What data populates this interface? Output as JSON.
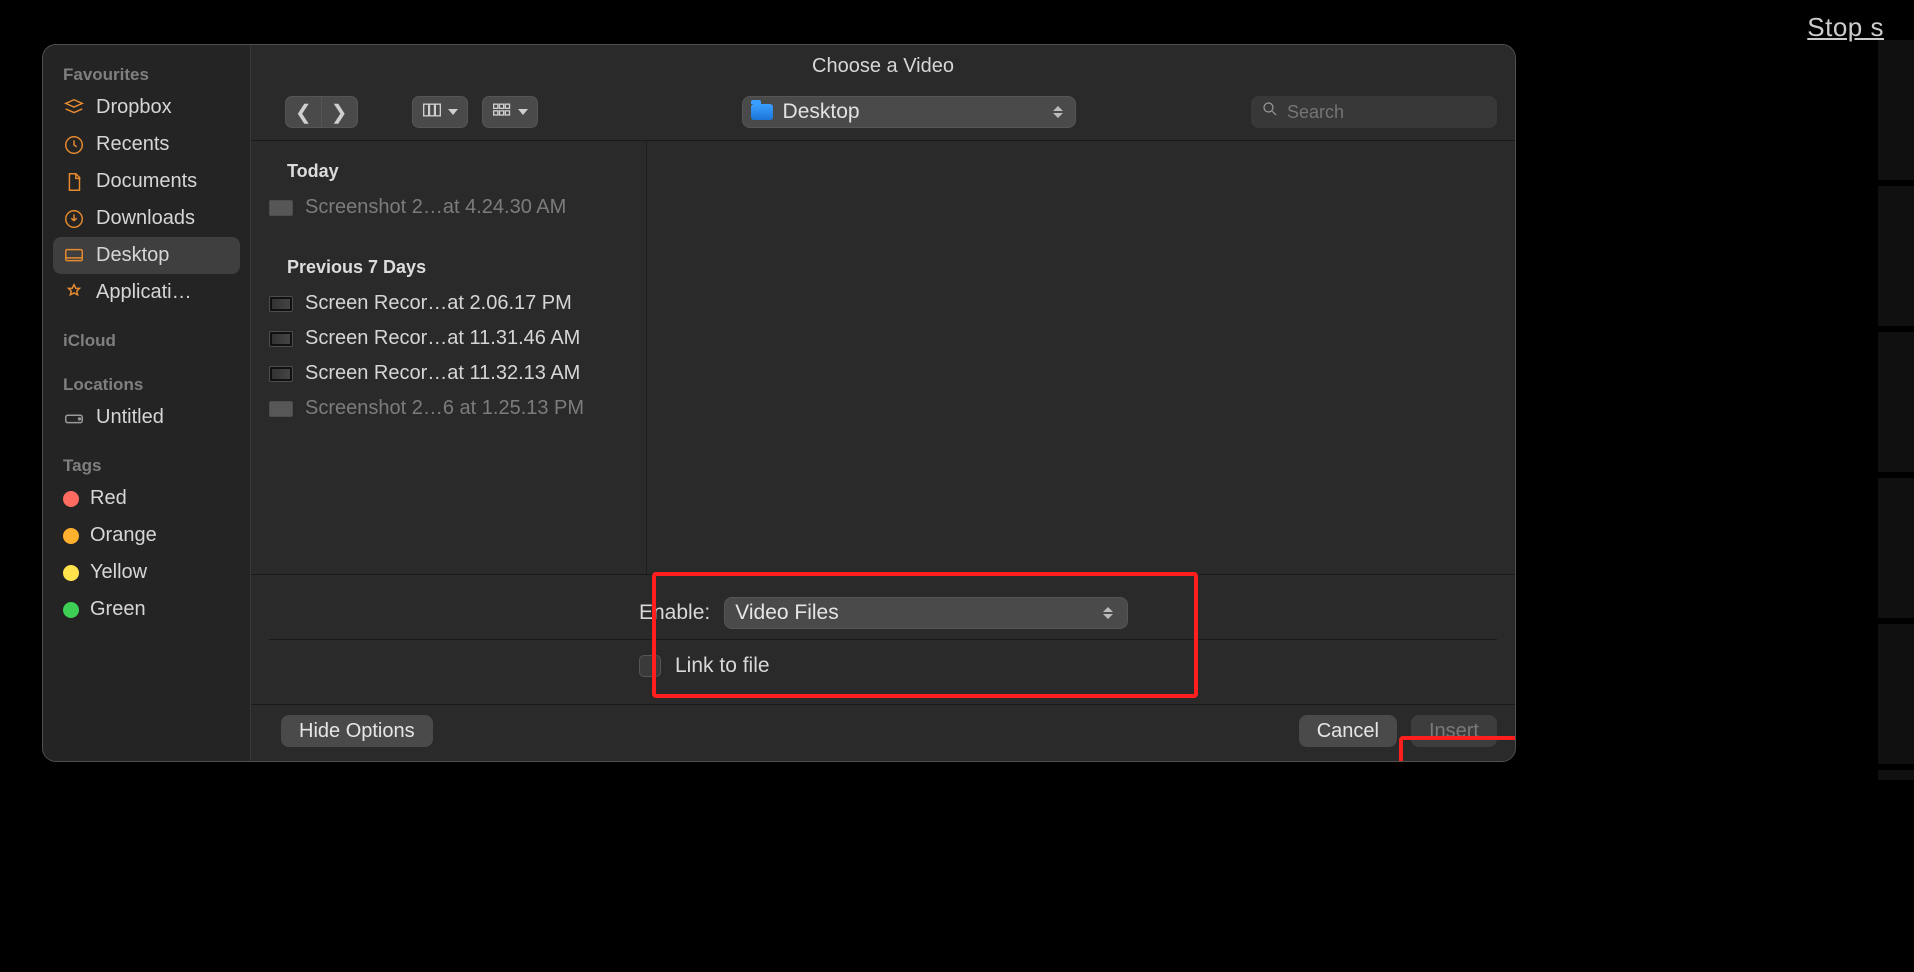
{
  "topbar": {
    "stop_share": "Stop s"
  },
  "dialog": {
    "title": "Choose a Video",
    "location": {
      "label": "Desktop"
    },
    "search": {
      "placeholder": "Search"
    },
    "sidebar": {
      "sections": [
        {
          "label": "Favourites",
          "items": [
            {
              "icon": "box",
              "label": "Dropbox"
            },
            {
              "icon": "clock",
              "label": "Recents"
            },
            {
              "icon": "doc",
              "label": "Documents"
            },
            {
              "icon": "download",
              "label": "Downloads"
            },
            {
              "icon": "desktop",
              "label": "Desktop",
              "selected": true
            },
            {
              "icon": "apps",
              "label": "Applicati…"
            }
          ]
        },
        {
          "label": "iCloud",
          "items": []
        },
        {
          "label": "Locations",
          "items": [
            {
              "icon": "disk",
              "label": "Untitled"
            }
          ]
        },
        {
          "label": "Tags",
          "items": [
            {
              "dot": "#ff6b60",
              "label": "Red"
            },
            {
              "dot": "#ffb02e",
              "label": "Orange"
            },
            {
              "dot": "#ffe34d",
              "label": "Yellow"
            },
            {
              "dot": "#3ecf55",
              "label": "Green"
            }
          ]
        }
      ]
    },
    "filelist": {
      "groups": [
        {
          "header": "Today",
          "rows": [
            {
              "kind": "image",
              "name": "Screenshot 2…at 4.24.30 AM",
              "disabled": true
            }
          ]
        },
        {
          "header": "Previous 7 Days",
          "rows": [
            {
              "kind": "video",
              "name": "Screen Recor…at 2.06.17 PM"
            },
            {
              "kind": "video",
              "name": "Screen Recor…at 11.31.46 AM"
            },
            {
              "kind": "video",
              "name": "Screen Recor…at 11.32.13 AM"
            },
            {
              "kind": "image",
              "name": "Screenshot 2…6 at 1.25.13 PM",
              "disabled": true
            }
          ]
        }
      ]
    },
    "options": {
      "enable_label": "Enable:",
      "enable_value": "Video Files",
      "link_label": "Link to file",
      "link_checked": false
    },
    "footer": {
      "hide_options": "Hide Options",
      "cancel": "Cancel",
      "insert": "Insert"
    }
  }
}
